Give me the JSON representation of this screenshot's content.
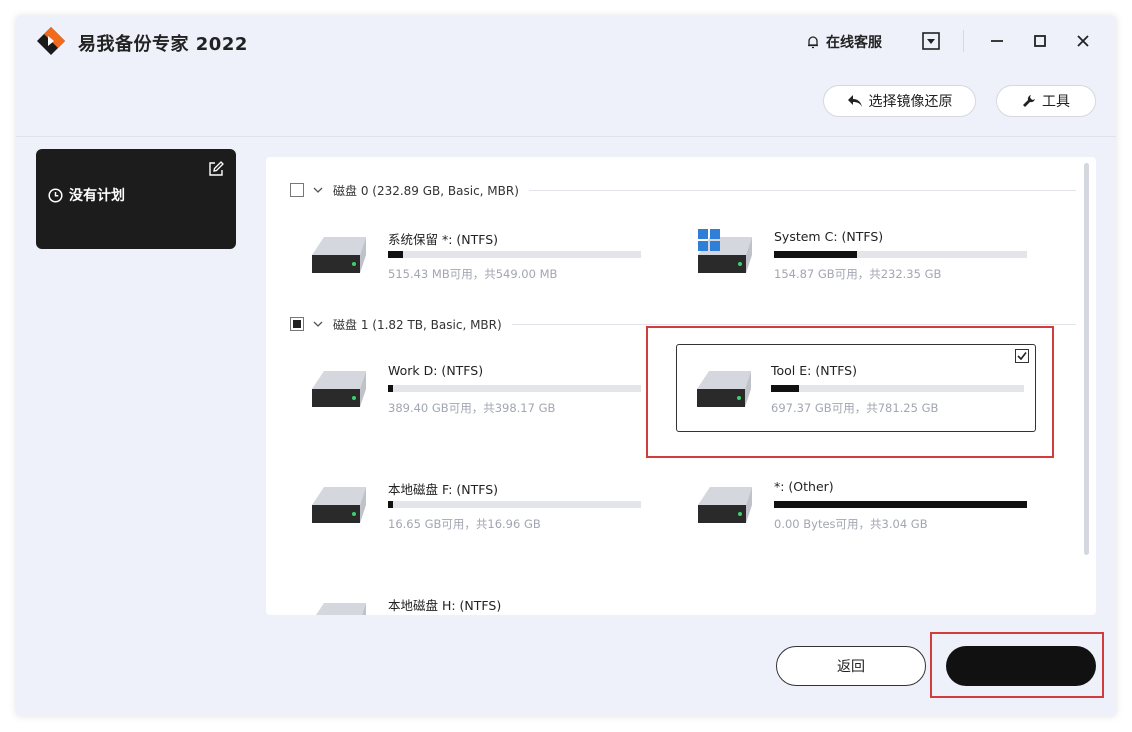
{
  "app": {
    "title": "易我备份专家 2022",
    "brand_color": "#f26b1d"
  },
  "titlebar": {
    "support_label": "在线客服",
    "icons": [
      "bell-icon",
      "menu-icon",
      "minimize-icon",
      "maximize-icon",
      "close-icon"
    ]
  },
  "toolbar": {
    "restore_label": "选择镜像还原",
    "tools_label": "工具"
  },
  "sidebar": {
    "plan_label": "没有计划"
  },
  "disks": [
    {
      "label": "磁盘 0 (232.89 GB, Basic, MBR)",
      "checked": "none",
      "partitions": [
        {
          "name": "系统保留 *: (NTFS)",
          "info": "515.43 MB可用，共549.00 MB",
          "used_fraction": 0.06,
          "windows": false,
          "selected": false
        },
        {
          "name": "System C: (NTFS)",
          "info": "154.87 GB可用，共232.35 GB",
          "used_fraction": 0.33,
          "windows": true,
          "selected": false
        }
      ]
    },
    {
      "label": "磁盘 1 (1.82 TB, Basic, MBR)",
      "checked": "partial",
      "partitions": [
        {
          "name": "Work D: (NTFS)",
          "info": "389.40 GB可用，共398.17 GB",
          "used_fraction": 0.02,
          "windows": false,
          "selected": false
        },
        {
          "name": "Tool E: (NTFS)",
          "info": "697.37 GB可用，共781.25 GB",
          "used_fraction": 0.11,
          "windows": false,
          "selected": true
        },
        {
          "name": "本地磁盘 F: (NTFS)",
          "info": "16.65 GB可用，共16.96 GB",
          "used_fraction": 0.02,
          "windows": false,
          "selected": false
        },
        {
          "name": "*: (Other)",
          "info": "0.00 Bytes可用，共3.04 GB",
          "used_fraction": 1.0,
          "windows": false,
          "selected": false
        },
        {
          "name": "本地磁盘 H: (NTFS)",
          "info": "",
          "used_fraction": 0.0,
          "windows": false,
          "selected": false
        }
      ]
    }
  ],
  "footer": {
    "back_label": "返回",
    "next_label": ""
  },
  "colors": {
    "annotation": "#d23c3c",
    "bar_fill": "#111111",
    "bar_track": "#e3e5ea",
    "windows_blue": "#2f7fd8"
  }
}
